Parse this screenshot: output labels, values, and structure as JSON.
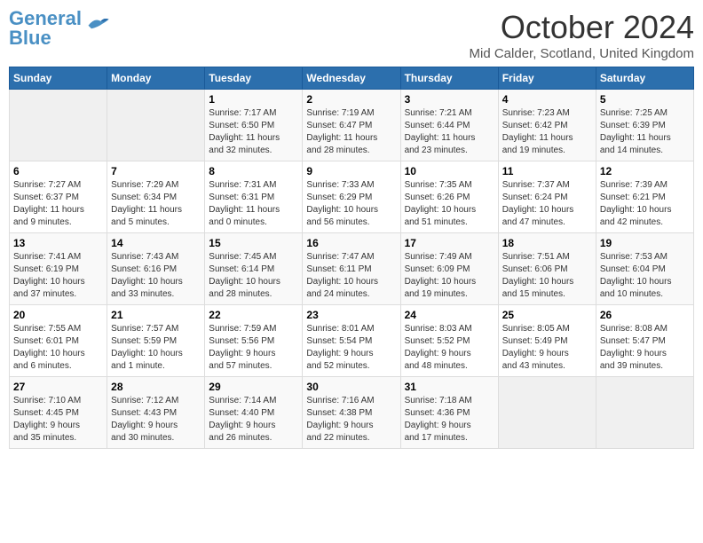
{
  "logo": {
    "line1": "General",
    "line2": "Blue"
  },
  "title": "October 2024",
  "subtitle": "Mid Calder, Scotland, United Kingdom",
  "days_of_week": [
    "Sunday",
    "Monday",
    "Tuesday",
    "Wednesday",
    "Thursday",
    "Friday",
    "Saturday"
  ],
  "weeks": [
    [
      {
        "day": "",
        "info": ""
      },
      {
        "day": "",
        "info": ""
      },
      {
        "day": "1",
        "info": "Sunrise: 7:17 AM\nSunset: 6:50 PM\nDaylight: 11 hours\nand 32 minutes."
      },
      {
        "day": "2",
        "info": "Sunrise: 7:19 AM\nSunset: 6:47 PM\nDaylight: 11 hours\nand 28 minutes."
      },
      {
        "day": "3",
        "info": "Sunrise: 7:21 AM\nSunset: 6:44 PM\nDaylight: 11 hours\nand 23 minutes."
      },
      {
        "day": "4",
        "info": "Sunrise: 7:23 AM\nSunset: 6:42 PM\nDaylight: 11 hours\nand 19 minutes."
      },
      {
        "day": "5",
        "info": "Sunrise: 7:25 AM\nSunset: 6:39 PM\nDaylight: 11 hours\nand 14 minutes."
      }
    ],
    [
      {
        "day": "6",
        "info": "Sunrise: 7:27 AM\nSunset: 6:37 PM\nDaylight: 11 hours\nand 9 minutes."
      },
      {
        "day": "7",
        "info": "Sunrise: 7:29 AM\nSunset: 6:34 PM\nDaylight: 11 hours\nand 5 minutes."
      },
      {
        "day": "8",
        "info": "Sunrise: 7:31 AM\nSunset: 6:31 PM\nDaylight: 11 hours\nand 0 minutes."
      },
      {
        "day": "9",
        "info": "Sunrise: 7:33 AM\nSunset: 6:29 PM\nDaylight: 10 hours\nand 56 minutes."
      },
      {
        "day": "10",
        "info": "Sunrise: 7:35 AM\nSunset: 6:26 PM\nDaylight: 10 hours\nand 51 minutes."
      },
      {
        "day": "11",
        "info": "Sunrise: 7:37 AM\nSunset: 6:24 PM\nDaylight: 10 hours\nand 47 minutes."
      },
      {
        "day": "12",
        "info": "Sunrise: 7:39 AM\nSunset: 6:21 PM\nDaylight: 10 hours\nand 42 minutes."
      }
    ],
    [
      {
        "day": "13",
        "info": "Sunrise: 7:41 AM\nSunset: 6:19 PM\nDaylight: 10 hours\nand 37 minutes."
      },
      {
        "day": "14",
        "info": "Sunrise: 7:43 AM\nSunset: 6:16 PM\nDaylight: 10 hours\nand 33 minutes."
      },
      {
        "day": "15",
        "info": "Sunrise: 7:45 AM\nSunset: 6:14 PM\nDaylight: 10 hours\nand 28 minutes."
      },
      {
        "day": "16",
        "info": "Sunrise: 7:47 AM\nSunset: 6:11 PM\nDaylight: 10 hours\nand 24 minutes."
      },
      {
        "day": "17",
        "info": "Sunrise: 7:49 AM\nSunset: 6:09 PM\nDaylight: 10 hours\nand 19 minutes."
      },
      {
        "day": "18",
        "info": "Sunrise: 7:51 AM\nSunset: 6:06 PM\nDaylight: 10 hours\nand 15 minutes."
      },
      {
        "day": "19",
        "info": "Sunrise: 7:53 AM\nSunset: 6:04 PM\nDaylight: 10 hours\nand 10 minutes."
      }
    ],
    [
      {
        "day": "20",
        "info": "Sunrise: 7:55 AM\nSunset: 6:01 PM\nDaylight: 10 hours\nand 6 minutes."
      },
      {
        "day": "21",
        "info": "Sunrise: 7:57 AM\nSunset: 5:59 PM\nDaylight: 10 hours\nand 1 minute."
      },
      {
        "day": "22",
        "info": "Sunrise: 7:59 AM\nSunset: 5:56 PM\nDaylight: 9 hours\nand 57 minutes."
      },
      {
        "day": "23",
        "info": "Sunrise: 8:01 AM\nSunset: 5:54 PM\nDaylight: 9 hours\nand 52 minutes."
      },
      {
        "day": "24",
        "info": "Sunrise: 8:03 AM\nSunset: 5:52 PM\nDaylight: 9 hours\nand 48 minutes."
      },
      {
        "day": "25",
        "info": "Sunrise: 8:05 AM\nSunset: 5:49 PM\nDaylight: 9 hours\nand 43 minutes."
      },
      {
        "day": "26",
        "info": "Sunrise: 8:08 AM\nSunset: 5:47 PM\nDaylight: 9 hours\nand 39 minutes."
      }
    ],
    [
      {
        "day": "27",
        "info": "Sunrise: 7:10 AM\nSunset: 4:45 PM\nDaylight: 9 hours\nand 35 minutes."
      },
      {
        "day": "28",
        "info": "Sunrise: 7:12 AM\nSunset: 4:43 PM\nDaylight: 9 hours\nand 30 minutes."
      },
      {
        "day": "29",
        "info": "Sunrise: 7:14 AM\nSunset: 4:40 PM\nDaylight: 9 hours\nand 26 minutes."
      },
      {
        "day": "30",
        "info": "Sunrise: 7:16 AM\nSunset: 4:38 PM\nDaylight: 9 hours\nand 22 minutes."
      },
      {
        "day": "31",
        "info": "Sunrise: 7:18 AM\nSunset: 4:36 PM\nDaylight: 9 hours\nand 17 minutes."
      },
      {
        "day": "",
        "info": ""
      },
      {
        "day": "",
        "info": ""
      }
    ]
  ]
}
